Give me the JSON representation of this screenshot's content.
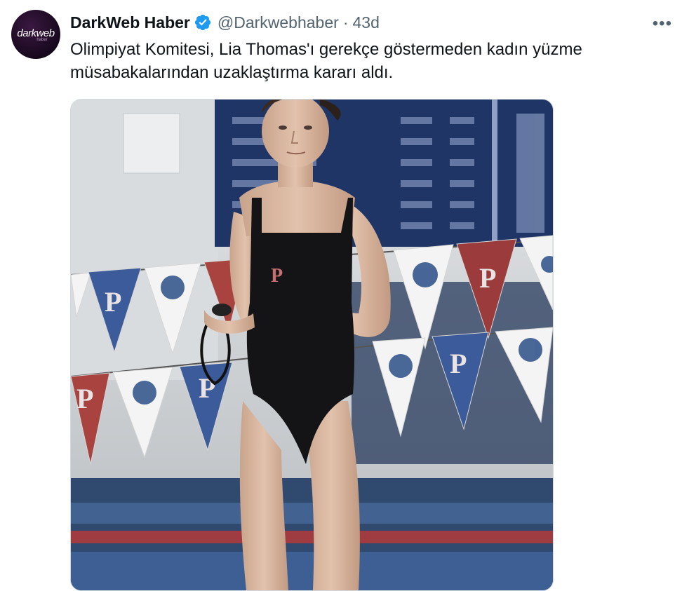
{
  "tweet": {
    "author_name": "DarkWeb Haber",
    "handle": "@Darkwebhaber",
    "separator": "·",
    "time": "43d",
    "more_icon": "more-horizontal-icon",
    "verified_icon": "verified-badge-icon",
    "text": "Olimpiyat Komitesi, Lia Thomas'ı gerekçe göstermeden kadın yüzme müsabakalarından uzaklaştırma kararı aldı."
  },
  "avatar": {
    "logo_text": "darkweb",
    "logo_sub": "haber"
  },
  "colors": {
    "verified": "#1d9bf0",
    "text": "#0f1419",
    "secondary": "#536471"
  }
}
